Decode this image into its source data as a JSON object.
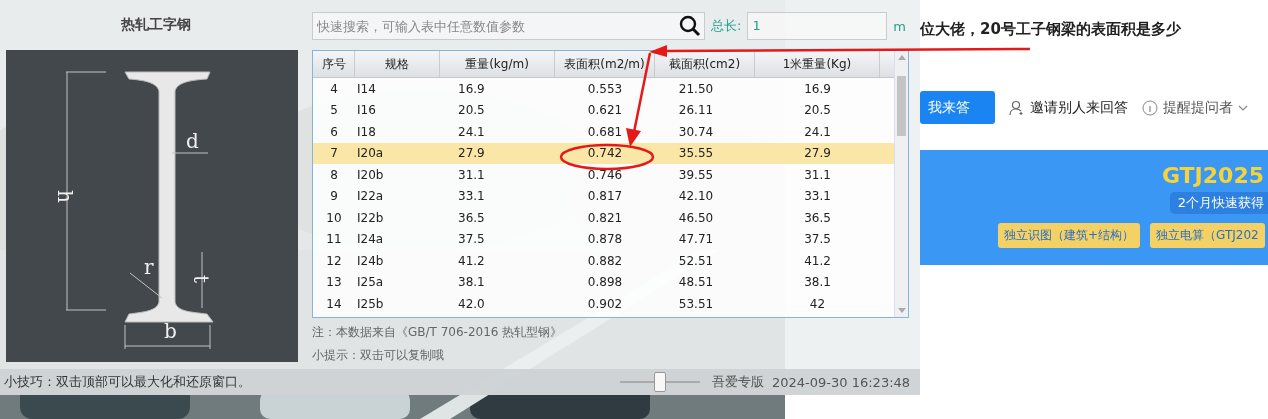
{
  "app": {
    "title": "热轧工字钢",
    "diagram_labels": [
      {
        "kind": "d",
        "text": "d"
      },
      {
        "kind": "h",
        "text": "h"
      },
      {
        "kind": "r",
        "text": "r"
      },
      {
        "kind": "t",
        "text": "t"
      },
      {
        "kind": "b",
        "text": "b"
      }
    ],
    "search": {
      "placeholder": "快速搜索，可输入表中任意数值参数"
    },
    "total_length": {
      "label": "总长:",
      "value": "1",
      "unit": "m"
    },
    "table": {
      "columns": [
        "序号",
        "规格",
        "重量(kg/m)",
        "表面积(m2/m)",
        "截面积(cm2)",
        "1米重量(Kg)"
      ],
      "rows": [
        {
          "cells": [
            "4",
            "I14",
            "16.9",
            "0.553",
            "21.50",
            "16.9"
          ],
          "selected": false
        },
        {
          "cells": [
            "5",
            "I16",
            "20.5",
            "0.621",
            "26.11",
            "20.5"
          ],
          "selected": false
        },
        {
          "cells": [
            "6",
            "I18",
            "24.1",
            "0.681",
            "30.74",
            "24.1"
          ],
          "selected": false
        },
        {
          "cells": [
            "7",
            "I20a",
            "27.9",
            "0.742",
            "35.55",
            "27.9"
          ],
          "selected": true
        },
        {
          "cells": [
            "8",
            "I20b",
            "31.1",
            "0.746",
            "39.55",
            "31.1"
          ],
          "selected": false
        },
        {
          "cells": [
            "9",
            "I22a",
            "33.1",
            "0.817",
            "42.10",
            "33.1"
          ],
          "selected": false
        },
        {
          "cells": [
            "10",
            "I22b",
            "36.5",
            "0.821",
            "46.50",
            "36.5"
          ],
          "selected": false
        },
        {
          "cells": [
            "11",
            "I24a",
            "37.5",
            "0.878",
            "47.71",
            "37.5"
          ],
          "selected": false
        },
        {
          "cells": [
            "12",
            "I24b",
            "41.2",
            "0.882",
            "52.51",
            "41.2"
          ],
          "selected": false
        },
        {
          "cells": [
            "13",
            "I25a",
            "38.1",
            "0.898",
            "48.51",
            "38.1"
          ],
          "selected": false
        },
        {
          "cells": [
            "14",
            "I25b",
            "42.0",
            "0.902",
            "53.51",
            "42"
          ],
          "selected": false
        }
      ]
    },
    "note": "注：本数据来自《GB/T  706-2016  热轧型钢》",
    "hint": "小提示：双击可以复制哦",
    "status_bar": {
      "tip": "小技巧：双击顶部可以最大化和还原窗口。",
      "slider": {
        "level": 0.5
      },
      "edition": "吾爱专版",
      "datetime": "2024-09-30 16:23:48"
    }
  },
  "web": {
    "question": "位大佬，20号工子钢梁的表面积是多少",
    "answer_button": "我来答",
    "invite": "邀请别人来回答",
    "remind": "提醒提问者",
    "banner": {
      "title": "GTJ2025",
      "subtitle": "2个月快速获得",
      "tags": [
        "独立识图（建筑+结构）",
        "独立电算（GTJ202"
      ]
    }
  }
}
